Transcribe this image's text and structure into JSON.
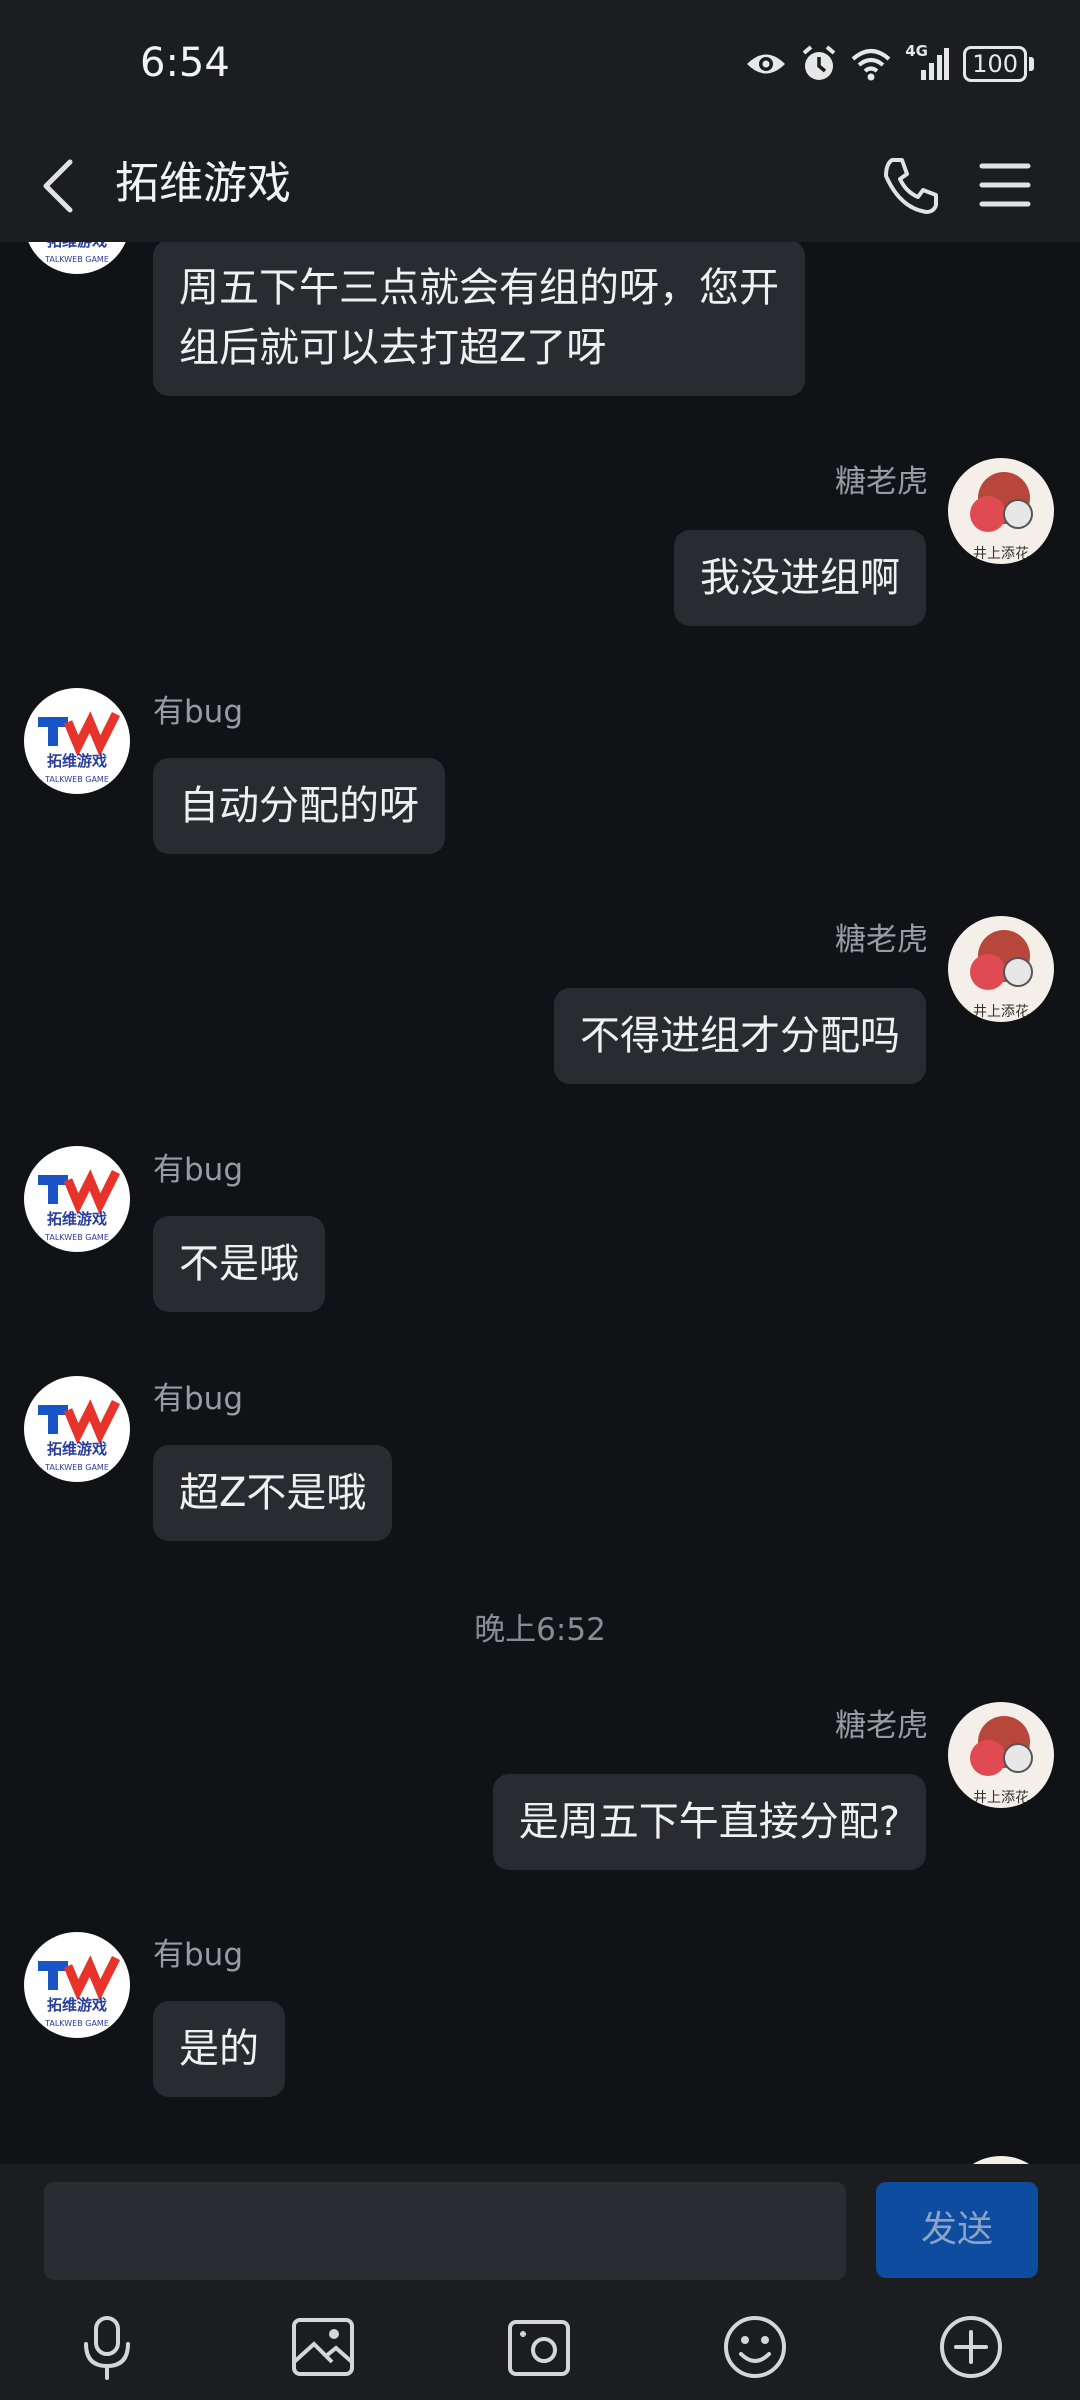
{
  "status_bar": {
    "time": "6:54",
    "network": "4G",
    "battery": "100",
    "icons": [
      "eye-icon",
      "alarm-icon",
      "wifi-icon",
      "signal-icon",
      "battery-icon"
    ]
  },
  "header": {
    "title": "拓维游戏",
    "icons": [
      "back-icon",
      "phone-icon",
      "menu-icon"
    ]
  },
  "messages": [
    {
      "side": "left",
      "sender": "",
      "text_lines": [
        "周五下午三点就会有组的呀，您开",
        "组后就可以去打超Z了呀"
      ]
    },
    {
      "side": "right",
      "sender": "糖老虎",
      "text": "我没进组啊"
    },
    {
      "side": "left",
      "sender": "有bug",
      "text": "自动分配的呀"
    },
    {
      "side": "right",
      "sender": "糖老虎",
      "text": "不得进组才分配吗"
    },
    {
      "side": "left",
      "sender": "有bug",
      "text": "不是哦"
    },
    {
      "side": "left",
      "sender": "有bug",
      "text": "超Z不是哦"
    },
    {
      "type": "timestamp",
      "text": "晚上6:52"
    },
    {
      "side": "right",
      "sender": "糖老虎",
      "text": "是周五下午直接分配?"
    },
    {
      "side": "left",
      "sender": "有bug",
      "text": "是的"
    }
  ],
  "avatars": {
    "left_logo_text": "拓维游戏",
    "left_logo_sub": "TALKWEB GAME",
    "right_avatar_text": "井上添花"
  },
  "input_bar": {
    "placeholder": "",
    "send_label": "发送",
    "tools": [
      "microphone-icon",
      "image-icon",
      "camera-icon",
      "emoji-icon",
      "plus-icon"
    ]
  },
  "colors": {
    "background": "#111216",
    "bar": "#1c1d21",
    "bubble": "#2a2b30",
    "send_button": "#0e4ca0"
  }
}
